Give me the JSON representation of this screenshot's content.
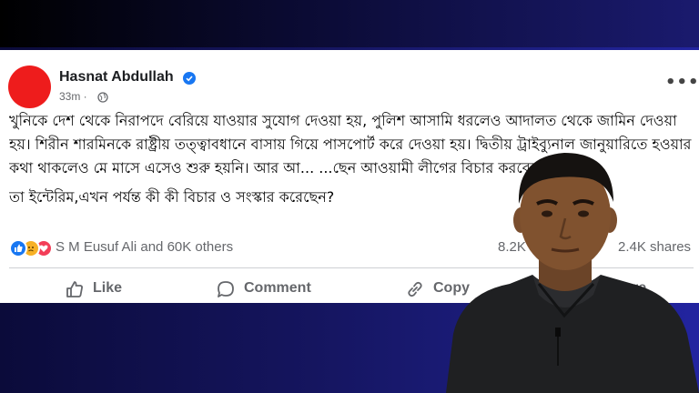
{
  "post": {
    "author": "Hasnat Abdullah",
    "time": "33m ·",
    "body_p1": "খুনিকে দেশ থেকে নিরাপদে বেরিয়ে যাওয়ার সুযোগ দেওয়া হয়, পুলিশ আসামি ধরলেও আদালত থেকে জামিন দেওয়া হয়। শিরীন শারমিনকে রাষ্ট্রীয় তত্ত্বাবধানে বাসায় গিয়ে পাসপোর্ট করে দেওয়া হয়। দ্বিতীয় ট্রাইব্যুনাল জানুয়ারিতে হওয়ার কথা থাকলেও মে মাসে এসেও শুরু হয়নি। আর আ... ...ছেন আওয়ামী লীগের বিচার করবেন?",
    "body_p2": "তা ইন্টেরিম,এখন পর্যন্ত কী কী বিচার ও সংস্কার করেছেন?"
  },
  "engagement": {
    "reaction_text": "S M Eusuf Ali and 60K others",
    "comments": "8.2K",
    "shares": "2.4K shares"
  },
  "actions": {
    "like": "Like",
    "comment": "Comment",
    "copy": "Copy",
    "share": "re"
  },
  "colors": {
    "avatar": "#ee1c1c",
    "verified": "#1877f2",
    "like": "#1877f2",
    "sad": "#f7b125",
    "love": "#f33e58"
  }
}
